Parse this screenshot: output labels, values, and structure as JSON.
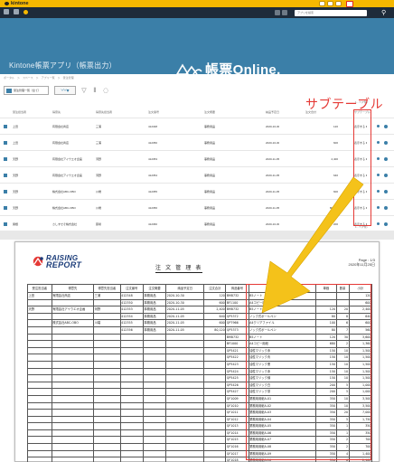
{
  "app": {
    "logo_text": "kintone",
    "search_placeholder": "アプリを検索",
    "app_title": "Kintone帳票アプリ（帳票出力）",
    "breadcrumb": "ポータル　＞　スペース　＞　アプリ一覧　＞　受注管理",
    "brand_text": "帳票Online."
  },
  "toolbar": {
    "view_label": "受注管理一覧（全て）",
    "annotation": "サブテーブル",
    "pager_top": "1 - 7 (7件)",
    "pager_bottom": "1 - 7 (7件)"
  },
  "list": {
    "headers": [
      "受注担当者",
      "得意先",
      "得意先担当者",
      "注文番号",
      "注文概要",
      "納品予定日",
      "注文合計",
      "サブテーブル"
    ],
    "rows": [
      {
        "c1": "上田",
        "c2": "有限会社商店",
        "c3": "三浦",
        "c4": "412348",
        "c5": "事務用品",
        "c6": "2020-10-30",
        "c7": "120",
        "c8": "表示する ▾"
      },
      {
        "c1": "上田",
        "c2": "有限会社商店",
        "c3": "三浦",
        "c4": "412350",
        "c5": "事務用品",
        "c6": "2020-10-30",
        "c7": "600",
        "c8": "表示する ▾"
      },
      {
        "c1": "天野",
        "c2": "有限会社アイウエオ企画",
        "c3": "河野",
        "c4": "412353",
        "c5": "事務用品",
        "c6": "2020-11-05",
        "c7": "2,400",
        "c8": "表示する ▾"
      },
      {
        "c1": "天野",
        "c2": "有限会社アイウエオ企画",
        "c3": "河野",
        "c4": "412354",
        "c5": "事務用品",
        "c6": "2020-11-05",
        "c7": "640",
        "c8": "表示する ▾"
      },
      {
        "c1": "天野",
        "c2": "株式会社ABC-OBO",
        "c3": "川端",
        "c4": "412355",
        "c5": "事務用品",
        "c6": "2020-11-05",
        "c7": "600",
        "c8": "表示する ▾"
      },
      {
        "c1": "天野",
        "c2": "株式会社ABC-OBO",
        "c3": "川端",
        "c4": "412356",
        "c5": "事務用品",
        "c6": "2020-11-05",
        "c7": "80,120",
        "c8": "表示する ▾"
      },
      {
        "c1": "関根",
        "c2": "さしすせそ株式会社",
        "c3": "蕨場",
        "c4": "412360",
        "c5": "事務用品",
        "c6": "2020-10-30",
        "c7": "200",
        "c8": "表示する ▾"
      }
    ]
  },
  "report": {
    "logo_line1": "RAISING",
    "logo_line2": "REPORT",
    "title": "注 文 管 理 表",
    "page": "Page : 1/3",
    "date": "2020年11月25日",
    "headers": [
      "受注担当者",
      "得意先",
      "得意先担当者",
      "注文番号",
      "注文概要",
      "納品予定日",
      "注文合計",
      "商品番号",
      "商品名",
      "単価",
      "数量",
      "小計"
    ],
    "rows": [
      [
        "上田",
        "有限会社商店",
        "三浦",
        "412348",
        "事務用品",
        "2020-10-30",
        "120",
        "BM8732",
        "B5ノート",
        "",
        "",
        "120"
      ],
      [
        "",
        "",
        "",
        "412350",
        "事務用品",
        "2020-10-30",
        "600",
        "BF1100",
        "A4コピー用紙",
        "",
        "",
        "600"
      ],
      [
        "天野",
        "有限会社アイウエオ企画",
        "河野",
        "412353",
        "事務用品",
        "2020-11-05",
        "2,400",
        "BM8732",
        "B5ノート",
        "120",
        "20",
        "2,400"
      ],
      [
        "",
        "",
        "",
        "412354",
        "事務用品",
        "2020-11-05",
        "640",
        "QP5372",
        "ノック式ボールペン",
        "80",
        "8",
        "640"
      ],
      [
        "",
        "株式会社ABC-OBO",
        "川端",
        "412355",
        "事務用品",
        "2020-11-05",
        "600",
        "QP7966",
        "A4クリアファイル",
        "100",
        "6",
        "600"
      ],
      [
        "",
        "",
        "",
        "412356",
        "事務用品",
        "2020-11-05",
        "80,120",
        "QP5373",
        "ノック式ボールペン",
        "80",
        "7",
        "560"
      ],
      [
        "",
        "",
        "",
        "",
        "",
        "",
        "",
        "BM8732",
        "B5ノート",
        "120",
        "30",
        "3,600"
      ],
      [
        "",
        "",
        "",
        "",
        "",
        "",
        "",
        "BF1000",
        "A4コピー用紙",
        "680",
        "2",
        "1,360"
      ],
      [
        "",
        "",
        "",
        "",
        "",
        "",
        "",
        "QP5421",
        "油性マジック赤",
        "150",
        "10",
        "1,500"
      ],
      [
        "",
        "",
        "",
        "",
        "",
        "",
        "",
        "QP5422",
        "油性マジック青",
        "150",
        "10",
        "1,500"
      ],
      [
        "",
        "",
        "",
        "",
        "",
        "",
        "",
        "QP5423",
        "油性マジック黒",
        "150",
        "10",
        "1,500"
      ],
      [
        "",
        "",
        "",
        "",
        "",
        "",
        "",
        "QP5424",
        "油性マジック赤",
        "150",
        "10",
        "1,500"
      ],
      [
        "",
        "",
        "",
        "",
        "",
        "",
        "",
        "QP5425",
        "油性マジック緑",
        "150",
        "10",
        "1,500"
      ],
      [
        "",
        "",
        "",
        "",
        "",
        "",
        "",
        "QP5426",
        "油性マジック白",
        "200",
        "5",
        "1,000"
      ],
      [
        "",
        "",
        "",
        "",
        "",
        "",
        "",
        "QP5427",
        "油性マジック茶",
        "200",
        "5",
        "1,000"
      ],
      [
        "",
        "",
        "",
        "",
        "",
        "",
        "",
        "QF1009",
        "業務用用紙A-01",
        "350",
        "10",
        "3,500"
      ],
      [
        "",
        "",
        "",
        "",
        "",
        "",
        "",
        "QF1010",
        "業務用用紙A-02",
        "350",
        "10",
        "3,500"
      ],
      [
        "",
        "",
        "",
        "",
        "",
        "",
        "",
        "QF1011",
        "業務用用紙A-03",
        "350",
        "20",
        "7,000"
      ],
      [
        "",
        "",
        "",
        "",
        "",
        "",
        "",
        "QF1012",
        "業務用用紙A-04",
        "350",
        "5",
        "1,750"
      ],
      [
        "",
        "",
        "",
        "",
        "",
        "",
        "",
        "QF1013",
        "業務用用紙A-05",
        "350",
        "1",
        "350"
      ],
      [
        "",
        "",
        "",
        "",
        "",
        "",
        "",
        "QF1014",
        "業務用用紙A-06",
        "350",
        "1",
        "350"
      ],
      [
        "",
        "",
        "",
        "",
        "",
        "",
        "",
        "QF1015",
        "業務用用紙A-07",
        "350",
        "2",
        "700"
      ],
      [
        "",
        "",
        "",
        "",
        "",
        "",
        "",
        "QF1016",
        "業務用用紙A-08",
        "350",
        "2",
        "700"
      ],
      [
        "",
        "",
        "",
        "",
        "",
        "",
        "",
        "QF1017",
        "業務用用紙A-09",
        "350",
        "4",
        "1,400"
      ],
      [
        "",
        "",
        "",
        "",
        "",
        "",
        "",
        "QF1018",
        "業務用用紙A-10",
        "350",
        "6",
        "2,100"
      ],
      [
        "",
        "",
        "",
        "",
        "",
        "",
        "",
        "QF1019",
        "業務用用紙A-11",
        "350",
        "3",
        "1,050"
      ]
    ]
  },
  "colors": {
    "kintone_yellow": "#f6b800",
    "nav_dark": "#1e2b3a",
    "app_blue": "#3b7fa8",
    "highlight_red": "#e53935",
    "arrow_yellow": "#f4c21a"
  }
}
